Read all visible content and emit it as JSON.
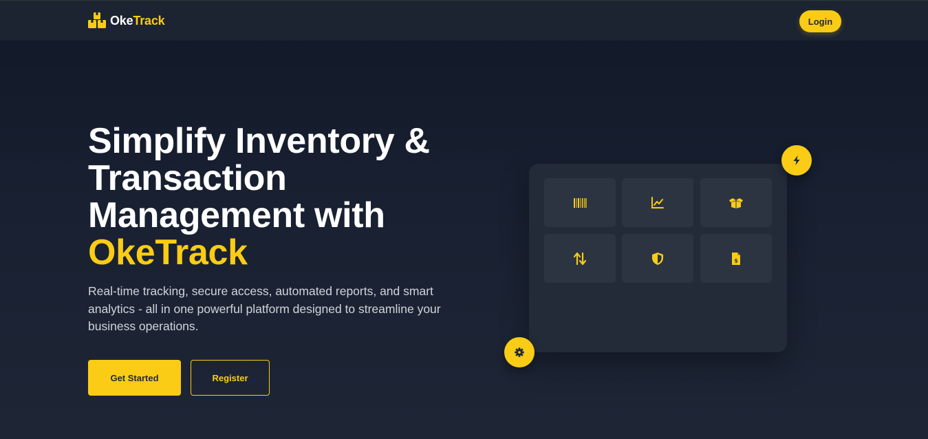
{
  "nav": {
    "brand_part1": "Oke",
    "brand_part2": "Track",
    "login_label": "Login"
  },
  "hero": {
    "title_line1": "Simplify Inventory &",
    "title_line2": "Transaction",
    "title_line3": "Management with",
    "title_accent": "OkeTrack",
    "description": "Real-time tracking, secure access, automated reports, and smart analytics - all in one powerful platform designed to streamline your business operations.",
    "primary_cta": "Get Started",
    "secondary_cta": "Register"
  },
  "feature_card": {
    "tiles": [
      {
        "icon": "barcode-icon"
      },
      {
        "icon": "chart-line-icon"
      },
      {
        "icon": "box-open-icon"
      },
      {
        "icon": "arrows-up-down-icon"
      },
      {
        "icon": "shield-icon"
      },
      {
        "icon": "invoice-dollar-icon"
      }
    ],
    "badges": [
      {
        "icon": "bolt-icon"
      },
      {
        "icon": "gear-icon"
      }
    ]
  },
  "colors": {
    "accent": "#facc15",
    "background": "#111827",
    "navbar": "#1c2331",
    "card": "#232b39",
    "tile": "#2c3442",
    "text_muted": "#d1d5db"
  }
}
